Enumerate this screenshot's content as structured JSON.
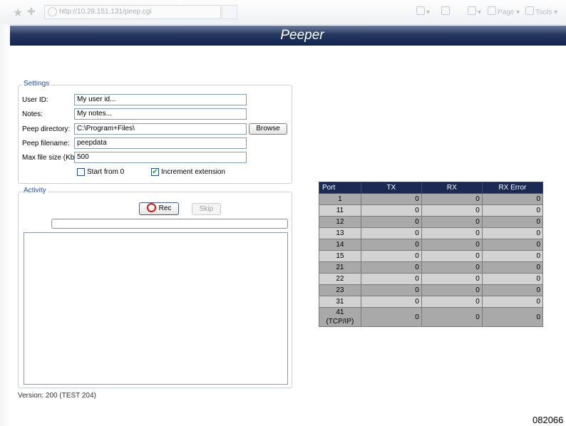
{
  "browser": {
    "url": "http://10.28.151.131/peep.cgi",
    "page_menu": "Page",
    "tools_menu": "Tools"
  },
  "app": {
    "title": "Peeper"
  },
  "settings": {
    "legend": "Settings",
    "user_id_label": "User ID:",
    "user_id_value": "My user id...",
    "notes_label": "Notes:",
    "notes_value": "My notes...",
    "peep_dir_label": "Peep directory:",
    "peep_dir_value": "C:\\Program+Files\\",
    "browse_label": "Browse",
    "peep_filename_label": "Peep filename:",
    "peep_filename_value": "peepdata",
    "max_file_size_label": "Max file size (Kb):",
    "max_file_size_value": "500",
    "start_from_zero_label": "Start from 0",
    "start_from_zero_checked": false,
    "increment_ext_label": "Increment extension",
    "increment_ext_checked": true
  },
  "activity": {
    "legend": "Activity",
    "rec_label": "Rec",
    "skip_label": "Skip",
    "progress": 0,
    "log": ""
  },
  "version": "Version: 200 (TEST 204)",
  "figure_id": "082066",
  "port_table": {
    "headers": [
      "Port",
      "TX",
      "RX",
      "RX Error"
    ],
    "rows": [
      [
        "1",
        "0",
        "0",
        "0"
      ],
      [
        "11",
        "0",
        "0",
        "0"
      ],
      [
        "12",
        "0",
        "0",
        "0"
      ],
      [
        "13",
        "0",
        "0",
        "0"
      ],
      [
        "14",
        "0",
        "0",
        "0"
      ],
      [
        "15",
        "0",
        "0",
        "0"
      ],
      [
        "21",
        "0",
        "0",
        "0"
      ],
      [
        "22",
        "0",
        "0",
        "0"
      ],
      [
        "23",
        "0",
        "0",
        "0"
      ],
      [
        "31",
        "0",
        "0",
        "0"
      ],
      [
        "41 (TCP/IP)",
        "0",
        "0",
        "0"
      ]
    ]
  }
}
